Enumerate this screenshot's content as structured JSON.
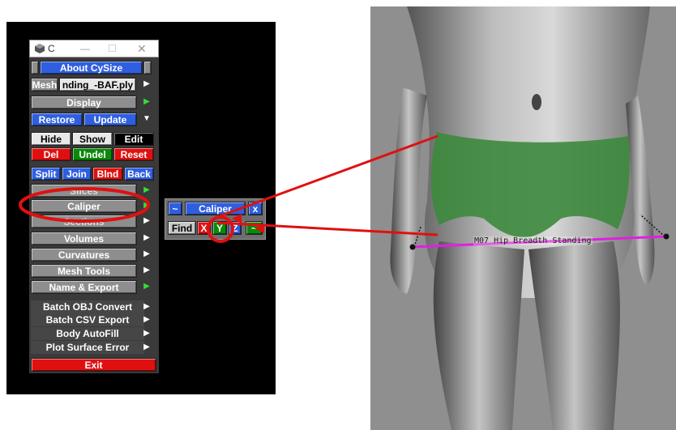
{
  "window": {
    "title": "C"
  },
  "menu": {
    "about": "About CySize",
    "mesh_label": "Mesh",
    "mesh_file": "nding_-BAF.ply",
    "display": "Display",
    "restore": "Restore",
    "update": "Update",
    "hide": "Hide",
    "show": "Show",
    "edit": "Edit",
    "del": "Del",
    "undel": "Undel",
    "reset": "Reset",
    "split": "Split",
    "join": "Join",
    "blnd": "Blnd",
    "back": "Back",
    "slices": "Slices",
    "caliper": "Caliper",
    "sections": "Sections",
    "volumes": "Volumes",
    "curvatures": "Curvatures",
    "mesh_tools": "Mesh Tools",
    "name_export": "Name & Export",
    "batch_obj": "Batch OBJ Convert",
    "batch_csv": "Batch CSV Export",
    "body_autofill": "Body AutoFill",
    "plot_surface": "Plot Surface Error",
    "exit": "Exit"
  },
  "caliper_popup": {
    "tilde": "~",
    "title": "Caliper",
    "close": "x",
    "find": "Find",
    "x_btn": "X",
    "y_btn": "Y",
    "z_btn": "Z",
    "minus": "~"
  },
  "measurement": {
    "label": "M07 Hip Breadth Standing"
  },
  "colors": {
    "highlight_red": "#e01010",
    "measure_magenta": "#e020e0",
    "region_green": "#3c8a3c"
  }
}
